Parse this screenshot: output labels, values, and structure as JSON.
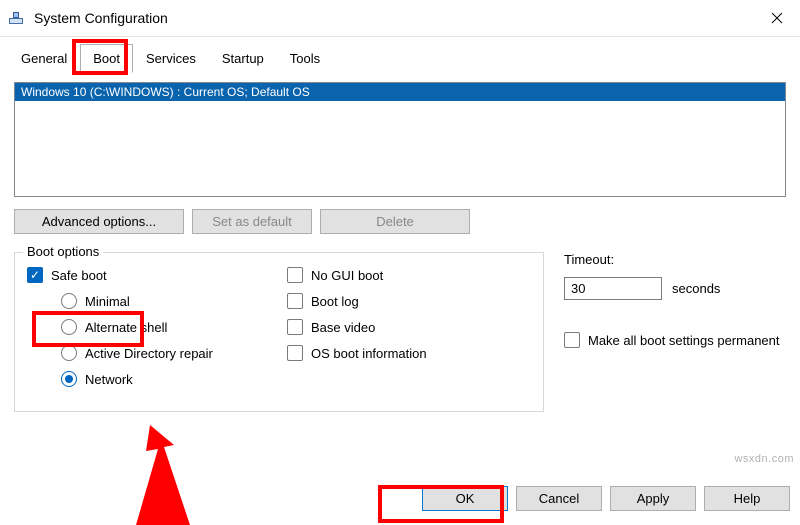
{
  "window": {
    "title": "System Configuration"
  },
  "tabs": {
    "items": [
      "General",
      "Boot",
      "Services",
      "Startup",
      "Tools"
    ],
    "active": 1
  },
  "oslist": {
    "items": [
      "Windows 10 (C:\\WINDOWS) : Current OS; Default OS"
    ],
    "selected": 0
  },
  "buttons": {
    "advanced": "Advanced options...",
    "set_default": "Set as default",
    "delete": "Delete"
  },
  "boot_options": {
    "legend": "Boot options",
    "safe_boot": {
      "label": "Safe boot",
      "checked": true
    },
    "radios": {
      "minimal": {
        "label": "Minimal",
        "selected": false
      },
      "altshell": {
        "label": "Alternate shell",
        "selected": false
      },
      "adrepair": {
        "label": "Active Directory repair",
        "selected": false
      },
      "network": {
        "label": "Network",
        "selected": true
      }
    },
    "no_gui": {
      "label": "No GUI boot",
      "checked": false
    },
    "boot_log": {
      "label": "Boot log",
      "checked": false
    },
    "base_vid": {
      "label": "Base video",
      "checked": false
    },
    "os_info": {
      "label": "OS boot information",
      "checked": false
    }
  },
  "timeout": {
    "label": "Timeout:",
    "value": "30",
    "unit": "seconds",
    "permanent": {
      "label": "Make all boot settings permanent",
      "checked": false
    }
  },
  "footer": {
    "ok": "OK",
    "cancel": "Cancel",
    "apply": "Apply",
    "help": "Help"
  },
  "watermark": "wsxdn.com"
}
